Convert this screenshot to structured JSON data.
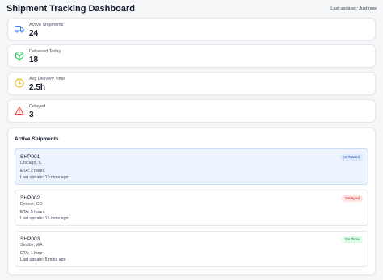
{
  "header": {
    "title": "Shipment Tracking Dashboard",
    "last_updated": "Last updated: Just now"
  },
  "stats": [
    {
      "label": "Active Shipments",
      "value": "24",
      "icon": "truck-icon",
      "color": "#3b82f6"
    },
    {
      "label": "Delivered Today",
      "value": "18",
      "icon": "package-icon",
      "color": "#22c55e"
    },
    {
      "label": "Avg Delivery Time",
      "value": "2.5h",
      "icon": "clock-icon",
      "color": "#eab308"
    },
    {
      "label": "Delayed",
      "value": "3",
      "icon": "alert-triangle-icon",
      "color": "#ef4444"
    }
  ],
  "panel": {
    "title": "Active Shipments"
  },
  "shipments": [
    {
      "id": "SHP001",
      "location": "Chicago, IL",
      "eta": "ETA: 2 hours",
      "last_update": "Last update: 10 mins ago",
      "status": "In Transit"
    },
    {
      "id": "SHP002",
      "location": "Denver, CO",
      "eta": "ETA: 5 hours",
      "last_update": "Last update: 15 mins ago",
      "status": "Delayed"
    },
    {
      "id": "SHP003",
      "location": "Seattle, WA",
      "eta": "ETA: 1 hour",
      "last_update": "Last update: 5 mins ago",
      "status": "On Time"
    }
  ]
}
